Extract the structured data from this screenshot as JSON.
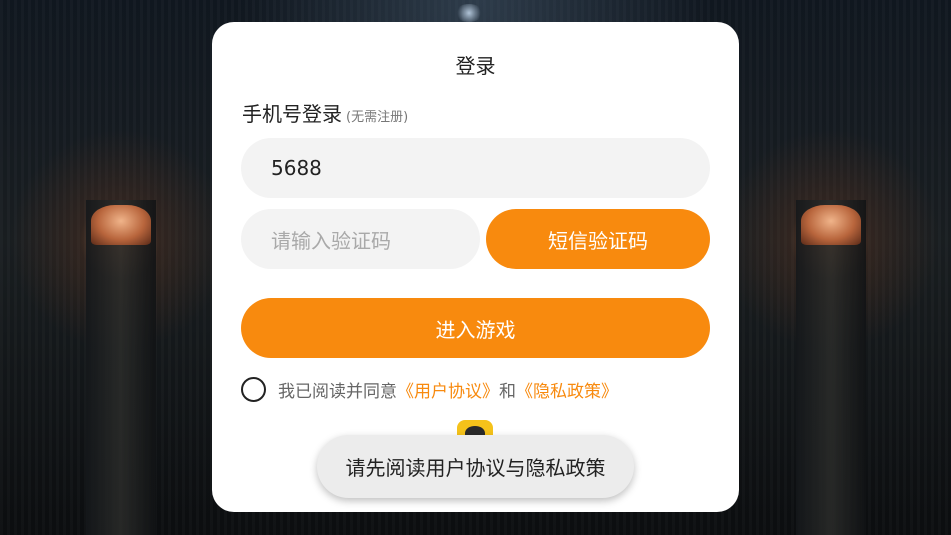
{
  "dialog": {
    "title": "登录",
    "section_title": "手机号登录",
    "section_hint": "(无需注册)",
    "phone_value": "5688",
    "code_placeholder": "请输入验证码",
    "sms_button": "短信验证码",
    "enter_button": "进入游戏",
    "agreement": {
      "prefix": "我已阅读并同意",
      "user_agreement": "《用户协议》",
      "and": "和",
      "privacy_policy": "《隐私政策》"
    }
  },
  "toast": {
    "message": "请先阅读用户协议与隐私政策"
  },
  "colors": {
    "accent": "#f88a0e",
    "field_bg": "#f3f3f3",
    "dialog_bg": "#ffffff"
  }
}
